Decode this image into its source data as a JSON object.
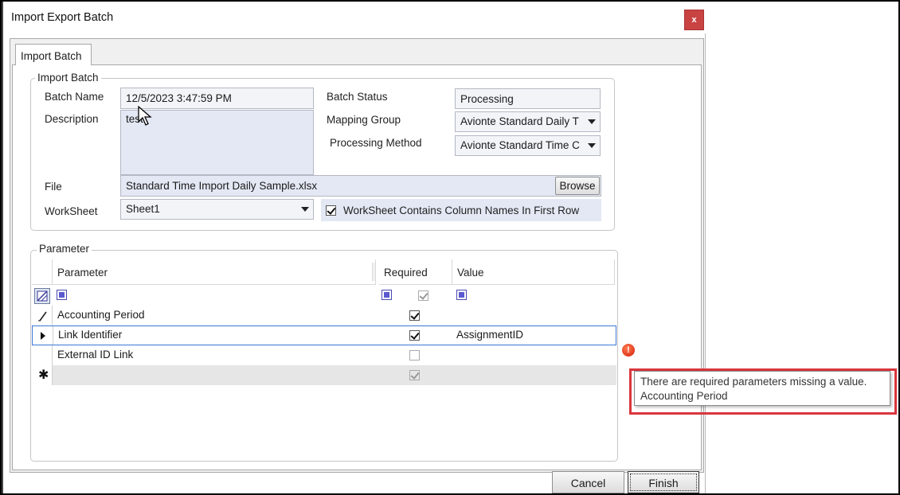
{
  "window": {
    "title": "Import Export Batch",
    "close_label": "x"
  },
  "tab": {
    "label": "Import Batch"
  },
  "import_batch": {
    "group_title": "Import Batch",
    "batch_name_label": "Batch Name",
    "batch_name_value": "12/5/2023 3:47:59 PM",
    "description_label": "Description",
    "description_value": "test",
    "batch_status_label": "Batch Status",
    "batch_status_value": "Processing",
    "mapping_group_label": "Mapping Group",
    "mapping_group_value": "Avionte Standard Daily T",
    "processing_method_label": "Processing Method",
    "processing_method_value": "Avionte Standard Time C",
    "file_label": "File",
    "file_value": "Standard Time Import Daily Sample.xlsx",
    "browse_label": "Browse",
    "worksheet_label": "WorkSheet",
    "worksheet_value": "Sheet1",
    "column_names_label": "WorkSheet Contains Column Names In First Row",
    "column_names_checked": true
  },
  "parameter": {
    "group_title": "Parameter",
    "columns": [
      "Parameter",
      "Required",
      "Value"
    ],
    "rows": [
      {
        "name": "Accounting Period",
        "required": true,
        "value": ""
      },
      {
        "name": "Link Identifier",
        "required": true,
        "value": "AssignmentID"
      },
      {
        "name": "External ID Link",
        "required": false,
        "value": ""
      }
    ]
  },
  "tooltip": {
    "line1": "There are required parameters missing a value.",
    "line2": "Accounting Period"
  },
  "footer": {
    "cancel_label": "Cancel",
    "finish_label": "Finish"
  },
  "colors": {
    "close_red": "#c94343",
    "highlight_red": "#d9363e",
    "selection_blue": "#3a78d6"
  }
}
